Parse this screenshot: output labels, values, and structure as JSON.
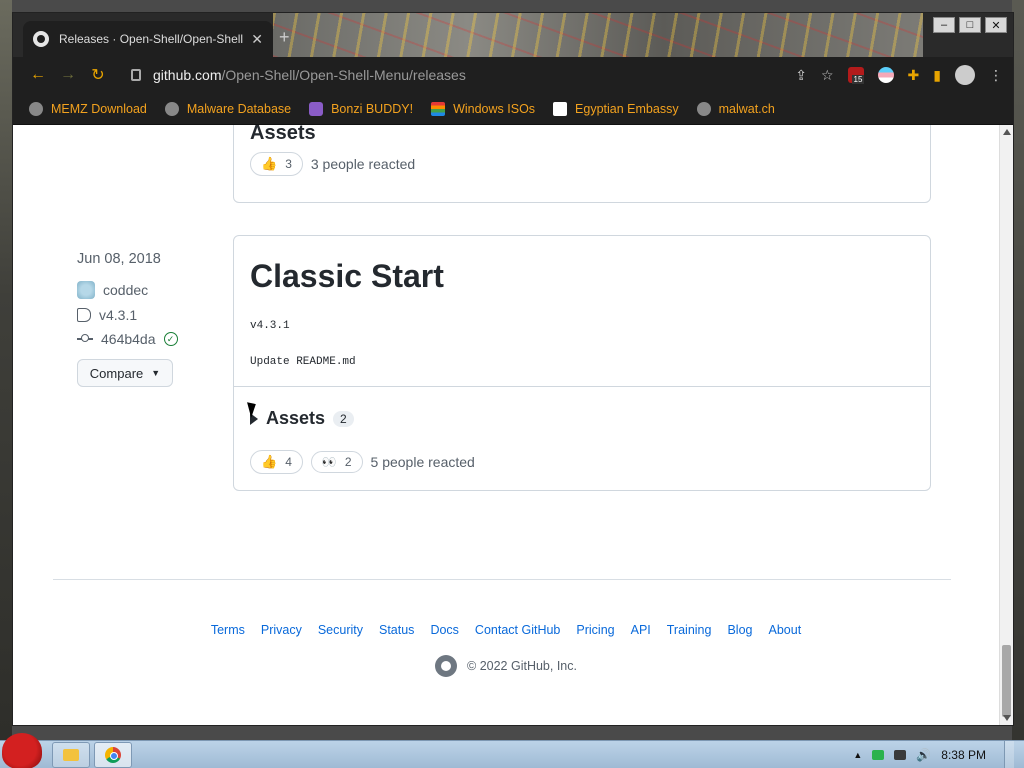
{
  "browser": {
    "tab_title": "Releases · Open-Shell/Open-Shell",
    "url_host": "github.com",
    "url_path": "/Open-Shell/Open-Shell-Menu/releases",
    "extension_badge": "15",
    "bookmarks": [
      {
        "label": "MEMZ Download",
        "icon": "globe-icon"
      },
      {
        "label": "Malware Database",
        "icon": "globe-icon"
      },
      {
        "label": "Bonzi BUDDY!",
        "icon": "bonzi-icon"
      },
      {
        "label": "Windows ISOs",
        "icon": "windows-flag-icon"
      },
      {
        "label": "Egyptian Embassy",
        "icon": "wix-icon"
      },
      {
        "label": "malwat.ch",
        "icon": "globe-icon"
      }
    ]
  },
  "previous_release": {
    "assets_partial": "Assets",
    "reaction_count": "3",
    "reacted_text": "3 people reacted"
  },
  "release": {
    "date": "Jun 08, 2018",
    "author": "coddec",
    "tag": "v4.3.1",
    "commit": "464b4da",
    "compare_label": "Compare",
    "title": "Classic Start",
    "version_line": "v4.3.1",
    "notes": "Update README.md",
    "assets_label": "Assets",
    "assets_count": "2",
    "reactions": [
      {
        "emoji": "thumbs-up",
        "count": "4"
      },
      {
        "emoji": "eyes",
        "count": "2"
      }
    ],
    "reacted_text": "5 people reacted"
  },
  "footer": {
    "links": [
      "Terms",
      "Privacy",
      "Security",
      "Status",
      "Docs",
      "Contact GitHub",
      "Pricing",
      "API",
      "Training",
      "Blog",
      "About"
    ],
    "copyright": "© 2022 GitHub, Inc."
  },
  "taskbar": {
    "clock": "8:38 PM"
  },
  "colors": {
    "link": "#0969da",
    "bookmark_text": "#f3a21f",
    "verified": "#1a7f37"
  }
}
